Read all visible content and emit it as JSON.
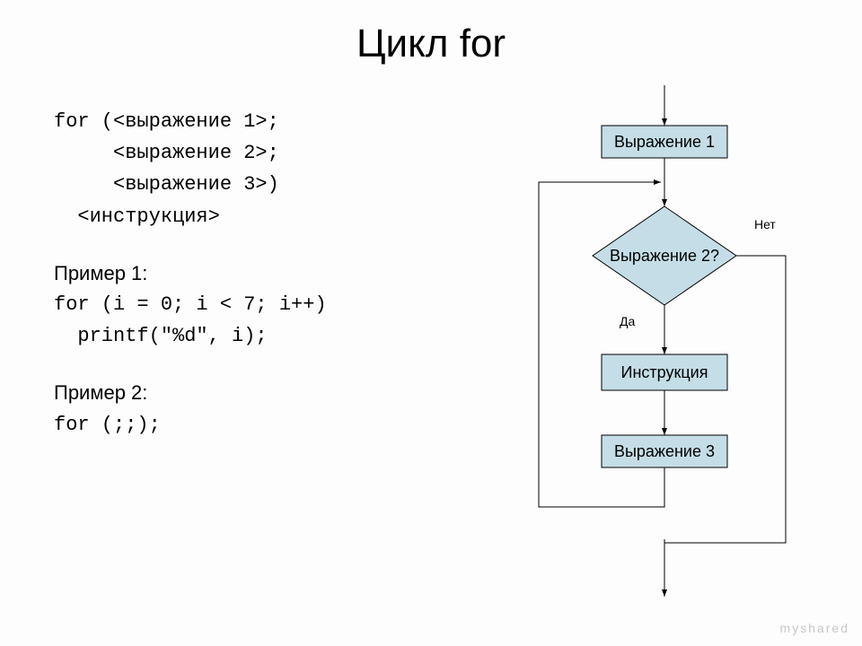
{
  "title": "Цикл for",
  "code": {
    "line1": "for (<выражение 1>;",
    "line2": "     <выражение 2>;",
    "line3": "     <выражение 3>)",
    "line4": "  <инструкция>",
    "ex1_h": "Пример 1:",
    "ex1_a": "for (i = 0; i < 7; i++)",
    "ex1_b": "  printf(\"%d\", i);",
    "ex2_h": "Пример 2:",
    "ex2_a": "for (;;);"
  },
  "diagram": {
    "box1": "Выражение 1",
    "decision": "Выражение 2?",
    "box2": "Инструкция",
    "box3": "Выражение 3",
    "yes": "Да",
    "no": "Нет"
  },
  "watermark": "myshared"
}
